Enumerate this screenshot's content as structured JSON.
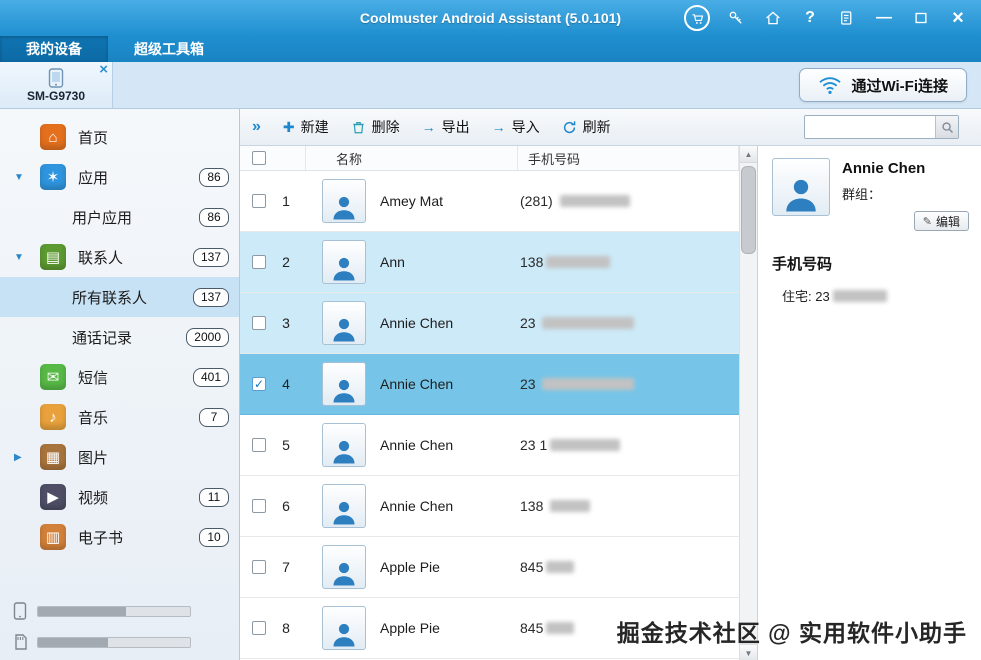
{
  "titlebar": {
    "title": "Coolmuster Android Assistant (5.0.101)"
  },
  "tabs": [
    {
      "id": "my-device",
      "label": "我的设备",
      "active": true
    },
    {
      "id": "super-toolkit",
      "label": "超级工具箱",
      "active": false
    }
  ],
  "device": {
    "name": "SM-G9730",
    "wifi_button_label": "通过Wi-Fi连接"
  },
  "sidebar": {
    "items": [
      {
        "id": "home",
        "label": "首页",
        "icon": "home"
      },
      {
        "id": "apps",
        "label": "应用",
        "icon": "apps",
        "badge": "86",
        "arrow": "down"
      },
      {
        "id": "user-apps",
        "label": "用户应用",
        "badge": "86",
        "child": true
      },
      {
        "id": "contacts",
        "label": "联系人",
        "icon": "contacts",
        "badge": "137",
        "arrow": "down"
      },
      {
        "id": "all-contacts",
        "label": "所有联系人",
        "badge": "137",
        "child": true,
        "selected": true
      },
      {
        "id": "call-logs",
        "label": "通话记录",
        "badge": "2000",
        "child": true
      },
      {
        "id": "sms",
        "label": "短信",
        "icon": "sms",
        "badge": "401"
      },
      {
        "id": "music",
        "label": "音乐",
        "icon": "music",
        "badge": "7"
      },
      {
        "id": "photos",
        "label": "图片",
        "icon": "photos",
        "arrow": "right"
      },
      {
        "id": "videos",
        "label": "视频",
        "icon": "videos",
        "badge": "11"
      },
      {
        "id": "ebooks",
        "label": "电子书",
        "icon": "ebooks",
        "badge": "10"
      }
    ]
  },
  "toolbar": {
    "buttons": [
      {
        "id": "new",
        "label": "新建",
        "icon": "plus"
      },
      {
        "id": "delete",
        "label": "删除",
        "icon": "trash"
      },
      {
        "id": "export",
        "label": "导出",
        "icon": "export"
      },
      {
        "id": "import",
        "label": "导入",
        "icon": "import"
      },
      {
        "id": "refresh",
        "label": "刷新",
        "icon": "refresh"
      }
    ],
    "search_placeholder": ""
  },
  "table": {
    "columns": {
      "name": "名称",
      "phone": "手机号码"
    },
    "rows": [
      {
        "index": "1",
        "name": "Amey Mat",
        "phone_prefix": "(281) ",
        "redact_width": 70,
        "state": "normal",
        "checked": false
      },
      {
        "index": "2",
        "name": "Ann",
        "phone_prefix": "138",
        "redact_width": 64,
        "state": "highlight",
        "checked": false
      },
      {
        "index": "3",
        "name": "Annie Chen",
        "phone_prefix": "23 ",
        "redact_width": 92,
        "state": "highlight",
        "checked": false
      },
      {
        "index": "4",
        "name": "Annie Chen",
        "phone_prefix": "23 ",
        "redact_width": 92,
        "state": "selected",
        "checked": true
      },
      {
        "index": "5",
        "name": "Annie Chen",
        "phone_prefix": "23 1",
        "redact_width": 70,
        "state": "normal",
        "checked": false
      },
      {
        "index": "6",
        "name": "Annie Chen",
        "phone_prefix": "138 ",
        "redact_width": 40,
        "state": "normal",
        "checked": false
      },
      {
        "index": "7",
        "name": "Apple Pie",
        "phone_prefix": "845",
        "redact_width": 28,
        "state": "normal",
        "checked": false
      },
      {
        "index": "8",
        "name": "Apple Pie",
        "phone_prefix": "845",
        "redact_width": 28,
        "state": "normal",
        "checked": false
      }
    ]
  },
  "detail": {
    "name": "Annie Chen",
    "group_label": "群组：",
    "edit_label": "编辑",
    "phone_section": "手机号码",
    "home_phone_prefix": "住宅: 23",
    "home_redact_width": 54
  },
  "watermark": "掘金技术社区 @ 实用软件小助手"
}
